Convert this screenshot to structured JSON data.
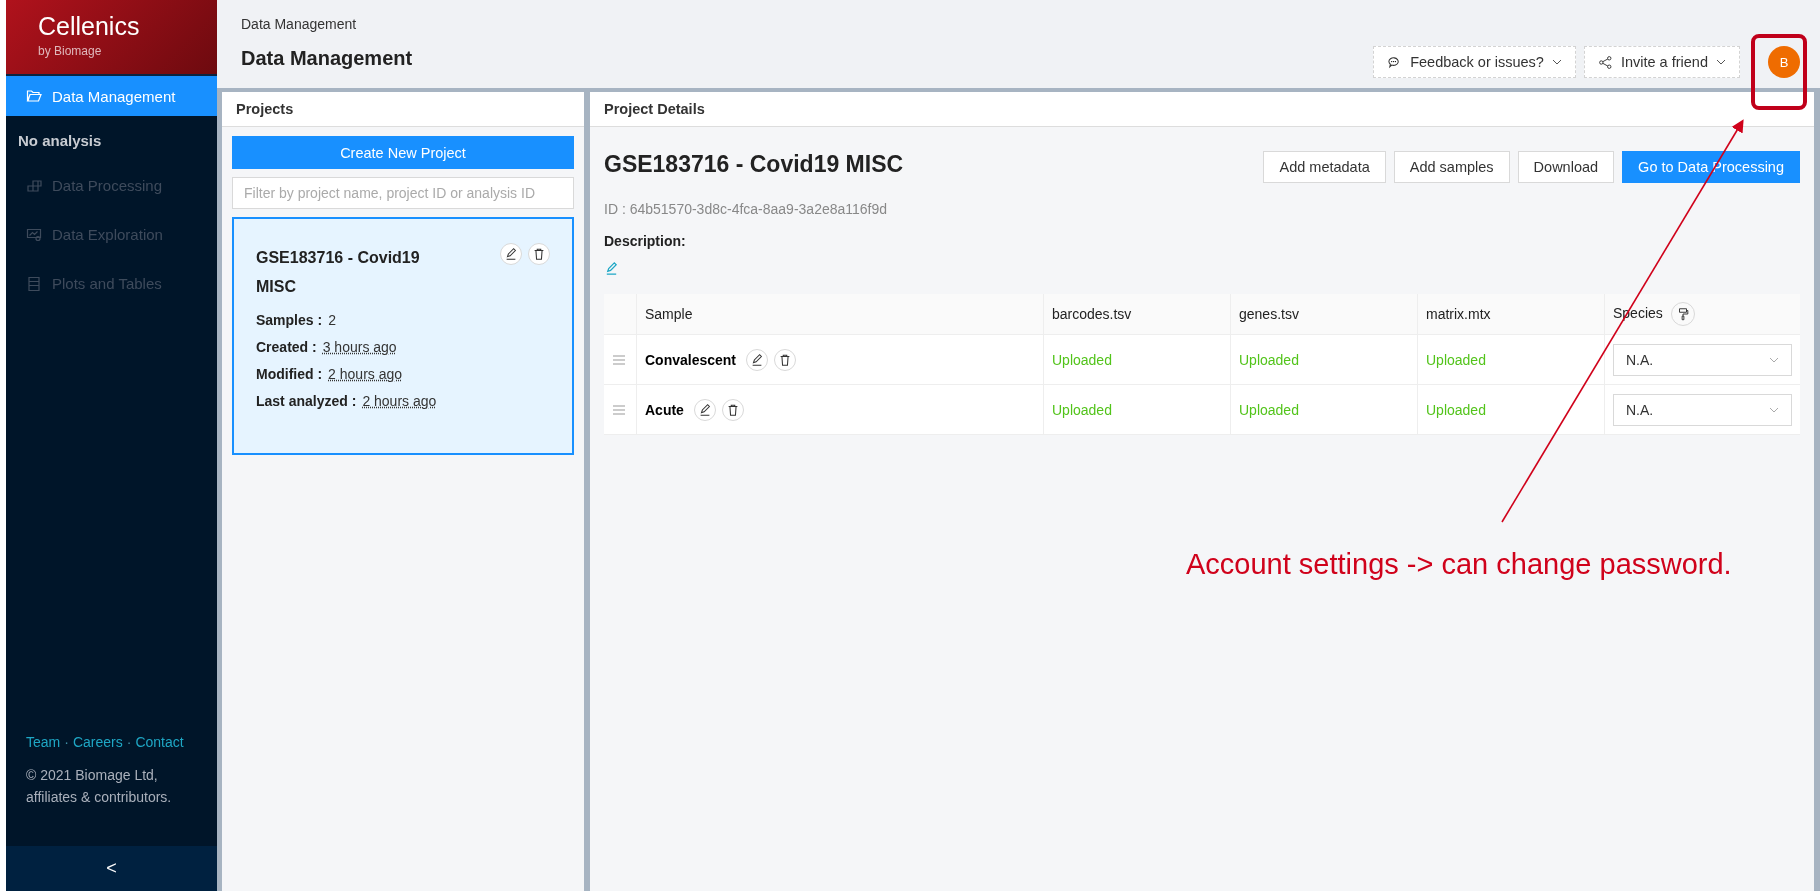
{
  "sidebar": {
    "logo": {
      "title": "Cellenics",
      "subtitle": "by Biomage"
    },
    "items": [
      {
        "label": "Data Management",
        "selected": true,
        "disabled": false
      }
    ],
    "section": "No analysis",
    "analysis_items": [
      {
        "label": "Data Processing",
        "selected": false,
        "disabled": true
      },
      {
        "label": "Data Exploration",
        "selected": false,
        "disabled": true
      },
      {
        "label": "Plots and Tables",
        "selected": false,
        "disabled": true
      }
    ],
    "footer_links": [
      {
        "kind": "link",
        "text": "Team"
      },
      {
        "kind": "separator",
        "text": "·"
      },
      {
        "kind": "link",
        "text": "Careers"
      },
      {
        "kind": "separator",
        "text": "·"
      },
      {
        "kind": "link",
        "text": "Contact"
      }
    ],
    "copyright": "© 2021 Biomage Ltd, affiliates & contributors.",
    "collapse": "<"
  },
  "header": {
    "breadcrumb": "Data Management",
    "title": "Data Management",
    "buttons": [
      {
        "label": "Feedback or issues?"
      },
      {
        "label": "Invite a friend"
      }
    ],
    "avatar": "B"
  },
  "projects_panel": {
    "title": "Projects",
    "create_button": "Create New Project",
    "filter": {
      "placeholder": "Filter by project name, project ID or analysis ID"
    },
    "projects": [
      {
        "name": "GSE183716 - Covid19 MISC",
        "selected": true,
        "fields": [
          {
            "label": "Samples :",
            "value": "2",
            "kind": "plain"
          },
          {
            "label": "Created :",
            "value": "3 hours ago",
            "kind": "time"
          },
          {
            "label": "Modified :",
            "value": "2 hours ago",
            "kind": "time"
          },
          {
            "label": "Last analyzed :",
            "value": "2 hours ago",
            "kind": "time"
          }
        ]
      }
    ]
  },
  "details_panel": {
    "title": "Project Details",
    "project_name": "GSE183716 - Covid19 MISC",
    "id": "ID : 64b51570-3d8c-4fca-8aa9-3a2e8a116f9d",
    "description_label": "Description:",
    "actions": [
      {
        "label": "Add metadata",
        "primary": false
      },
      {
        "label": "Add samples",
        "primary": false
      },
      {
        "label": "Download",
        "primary": false
      },
      {
        "label": "Go to Data Processing",
        "primary": true
      }
    ],
    "table": {
      "columns": [
        "Sample",
        "barcodes.tsv",
        "genes.tsv",
        "matrix.mtx",
        "Species"
      ],
      "rows": [
        {
          "name": "Convalescent",
          "files": [
            "Uploaded",
            "Uploaded",
            "Uploaded"
          ],
          "species": "N.A."
        },
        {
          "name": "Acute",
          "files": [
            "Uploaded",
            "Uploaded",
            "Uploaded"
          ],
          "species": "N.A."
        }
      ]
    }
  },
  "annotation": {
    "text": "Account settings -> can change password."
  }
}
